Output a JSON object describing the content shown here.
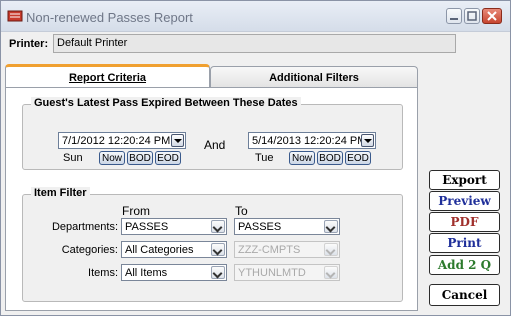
{
  "window": {
    "title": "Non-renewed Passes Report",
    "minimize_icon": "minimize-icon",
    "maximize_icon": "maximize-icon",
    "close_icon": "close-icon"
  },
  "printer": {
    "label": "Printer:",
    "value": "Default Printer"
  },
  "tabs": [
    {
      "label": "Report Criteria",
      "active": true
    },
    {
      "label": "Additional Filters",
      "active": false
    }
  ],
  "date_group": {
    "title": "Guest's Latest Pass Expired Between These Dates",
    "and_label": "And",
    "start": {
      "value": "7/1/2012 12:20:24 PM",
      "day": "Sun"
    },
    "end": {
      "value": "5/14/2013 12:20:24 PM",
      "day": "Tue"
    },
    "now_label": "Now",
    "bod_label": "BOD",
    "eod_label": "EOD"
  },
  "item_filter": {
    "title": "Item Filter",
    "from_label": "From",
    "to_label": "To",
    "rows": [
      {
        "label": "Departments:",
        "from": "PASSES",
        "to": "PASSES",
        "to_enabled": true
      },
      {
        "label": "Categories:",
        "from": "All Categories",
        "to": "ZZZ-CMPTS",
        "to_enabled": false
      },
      {
        "label": "Items:",
        "from": "All Items",
        "to": "YTHUNLMTD",
        "to_enabled": false
      }
    ]
  },
  "actions": {
    "export": "Export",
    "preview": "Preview",
    "pdf": "PDF",
    "print": "Print",
    "add2q": "Add 2 Q",
    "cancel": "Cancel"
  },
  "colors": {
    "accent_tab": "#f0a030",
    "preview": "#1f2f9a",
    "pdf": "#a0302c",
    "add2q": "#2c7a2c"
  }
}
